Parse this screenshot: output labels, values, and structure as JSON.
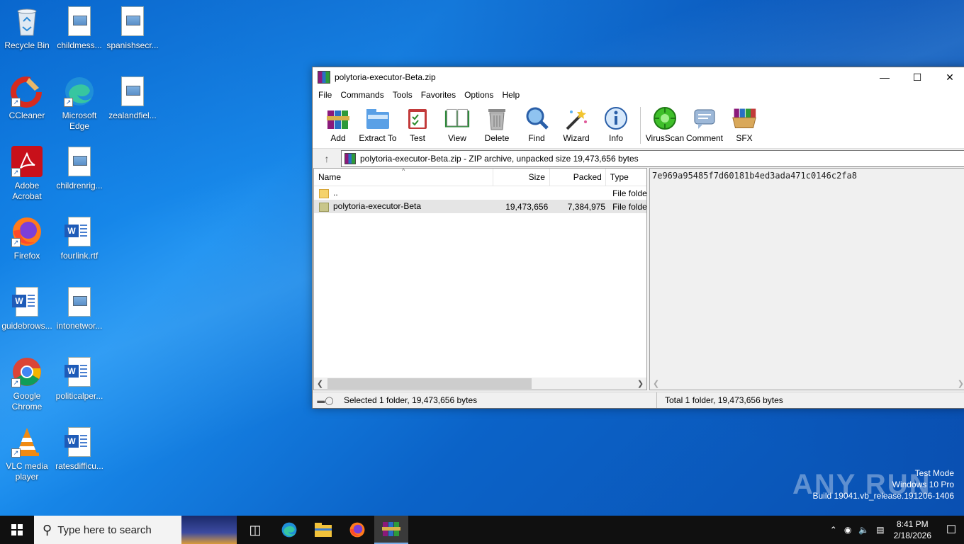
{
  "desktop": {
    "icons": [
      {
        "label": "Recycle Bin"
      },
      {
        "label": "childmess..."
      },
      {
        "label": "spanishsecr..."
      },
      {
        "label": "CCleaner"
      },
      {
        "label": "Microsoft Edge"
      },
      {
        "label": "zealandfiel..."
      },
      {
        "label": "Adobe Acrobat"
      },
      {
        "label": "childrenrig..."
      },
      {
        "label": "Firefox"
      },
      {
        "label": "fourlink.rtf"
      },
      {
        "label": "guidebrows..."
      },
      {
        "label": "intonetwor..."
      },
      {
        "label": "Google Chrome"
      },
      {
        "label": "politicalper..."
      },
      {
        "label": "VLC media player"
      },
      {
        "label": "ratesdifficu..."
      }
    ]
  },
  "window": {
    "title": "polytoria-executor-Beta.zip",
    "menu": [
      "File",
      "Commands",
      "Tools",
      "Favorites",
      "Options",
      "Help"
    ],
    "toolbar": [
      "Add",
      "Extract To",
      "Test",
      "View",
      "Delete",
      "Find",
      "Wizard",
      "Info",
      "VirusScan",
      "Comment",
      "SFX"
    ],
    "address": "polytoria-executor-Beta.zip - ZIP archive, unpacked size 19,473,656 bytes",
    "columns": {
      "name": "Name",
      "size": "Size",
      "packed": "Packed",
      "type": "Type"
    },
    "rows": [
      {
        "name": "..",
        "size": "",
        "packed": "",
        "type": "File folde"
      },
      {
        "name": "polytoria-executor-Beta",
        "size": "19,473,656",
        "packed": "7,384,975",
        "type": "File folde"
      }
    ],
    "comment": "7e969a95485f7d60181b4ed3ada471c0146c2fa8",
    "status_left": "Selected 1 folder, 19,473,656 bytes",
    "status_right": "Total 1 folder, 19,473,656 bytes"
  },
  "watermark": {
    "logo": "ANY RUN",
    "line1": "Test Mode",
    "line2": "Windows 10 Pro",
    "line3": "Build 19041.vb_release.191206-1406"
  },
  "taskbar": {
    "search_placeholder": "Type here to search",
    "time": "8:41 PM",
    "date": "2/18/2026"
  }
}
